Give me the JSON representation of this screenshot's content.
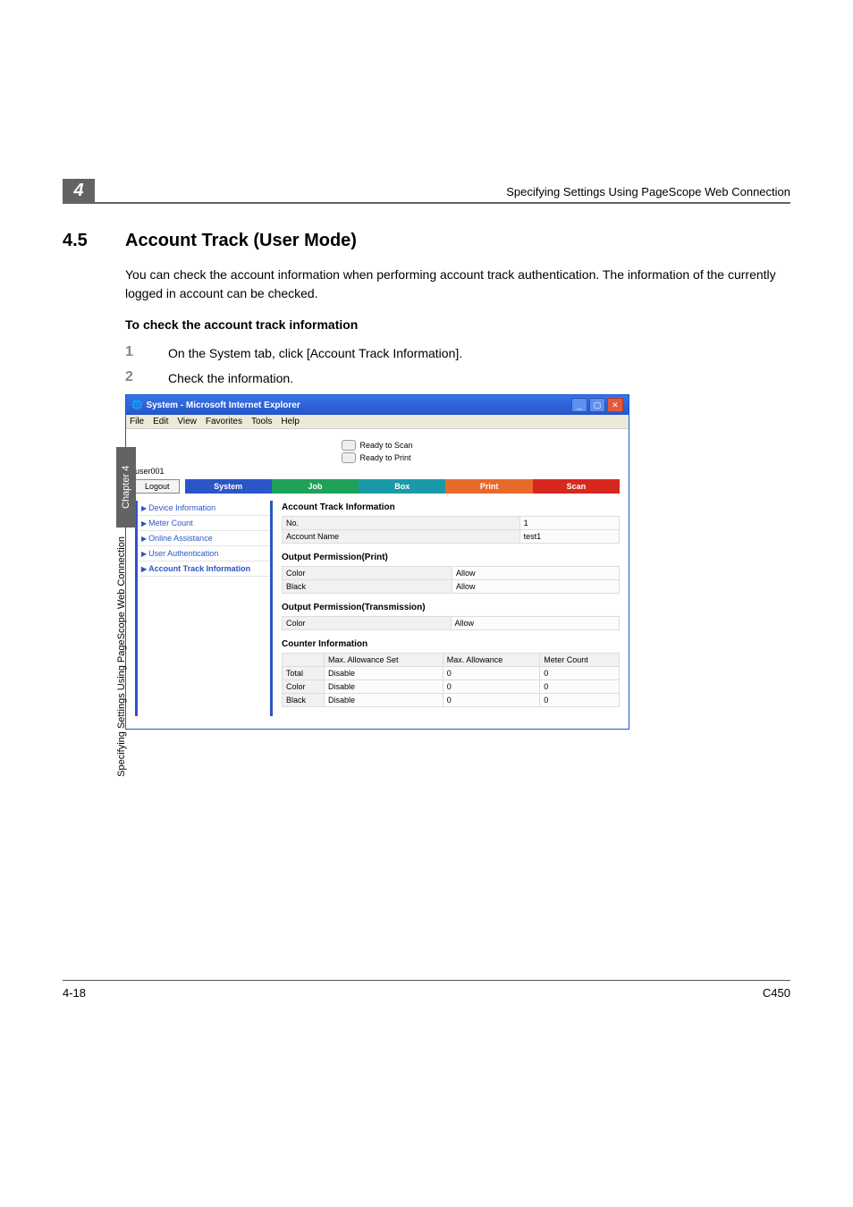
{
  "running_head": {
    "chapter_number": "4",
    "title": "Specifying Settings Using PageScope Web Connection"
  },
  "section": {
    "number": "4.5",
    "title": "Account Track (User Mode)",
    "intro": "You can check the account information when performing account track authentication. The information of the currently logged in account can be checked.",
    "subhead": "To check the account track information",
    "steps": [
      {
        "n": "1",
        "t": "On the System tab, click [Account Track Information]."
      },
      {
        "n": "2",
        "t": "Check the information."
      }
    ]
  },
  "side_tab": {
    "chapter": "Chapter 4",
    "subtitle": "Specifying Settings Using PageScope Web Connection"
  },
  "footer": {
    "left": "4-18",
    "right": "C450"
  },
  "screenshot": {
    "window_title": "System - Microsoft Internet Explorer",
    "menus": [
      "File",
      "Edit",
      "View",
      "Favorites",
      "Tools",
      "Help"
    ],
    "status": {
      "scan": "Ready to Scan",
      "print": "Ready to Print"
    },
    "user": "user001",
    "logout": "Logout",
    "tabs": {
      "system": "System",
      "job": "Job",
      "box": "Box",
      "print": "Print",
      "scan": "Scan"
    },
    "sidebar": [
      "Device Information",
      "Meter Count",
      "Online Assistance",
      "User Authentication",
      "Account Track Information"
    ],
    "content": {
      "title": "Account Track Information",
      "table1": {
        "rows": [
          {
            "k": "No.",
            "v": "1"
          },
          {
            "k": "Account Name",
            "v": "test1"
          }
        ]
      },
      "opp_title": "Output Permission(Print)",
      "opp": [
        {
          "k": "Color",
          "v": "Allow"
        },
        {
          "k": "Black",
          "v": "Allow"
        }
      ],
      "opt_title": "Output Permission(Transmission)",
      "opt": [
        {
          "k": "Color",
          "v": "Allow"
        }
      ],
      "ci_title": "Counter Information",
      "ci_head": [
        "",
        "Max. Allowance Set",
        "Max. Allowance",
        "Meter Count"
      ],
      "ci_rows": [
        [
          "Total",
          "Disable",
          "0",
          "0"
        ],
        [
          "Color",
          "Disable",
          "0",
          "0"
        ],
        [
          "Black",
          "Disable",
          "0",
          "0"
        ]
      ]
    }
  }
}
